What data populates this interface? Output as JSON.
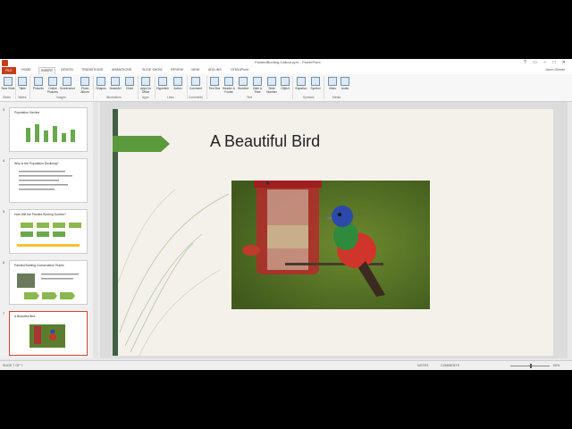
{
  "window": {
    "title": "PaintedBunting-Callout.pptx - PowerPoint",
    "controls": "? ▭ – □ ✕"
  },
  "tabs": [
    {
      "label": "FILE"
    },
    {
      "label": "HOME"
    },
    {
      "label": "INSERT"
    },
    {
      "label": "DESIGN"
    },
    {
      "label": "TRANSITIONS"
    },
    {
      "label": "ANIMATIONS"
    },
    {
      "label": "SLIDE SHOW"
    },
    {
      "label": "REVIEW"
    },
    {
      "label": "VIEW"
    },
    {
      "label": "ADD-INS"
    },
    {
      "label": "HTML5Point"
    }
  ],
  "user": "Jason Gilman",
  "ribbon": {
    "buttons": [
      {
        "label": "New Slide"
      },
      {
        "label": "Table"
      },
      {
        "label": "Pictures"
      },
      {
        "label": "Online Pictures"
      },
      {
        "label": "Screenshot"
      },
      {
        "label": "Photo Album"
      },
      {
        "label": "Shapes"
      },
      {
        "label": "SmartArt"
      },
      {
        "label": "Chart"
      },
      {
        "label": "Apps for Office"
      },
      {
        "label": "Hyperlink"
      },
      {
        "label": "Action"
      },
      {
        "label": "Comment"
      },
      {
        "label": "Text Box"
      },
      {
        "label": "Header & Footer"
      },
      {
        "label": "WordArt"
      },
      {
        "label": "Date & Time"
      },
      {
        "label": "Slide Number"
      },
      {
        "label": "Object"
      },
      {
        "label": "Equation"
      },
      {
        "label": "Symbol"
      },
      {
        "label": "Video"
      },
      {
        "label": "Audio"
      }
    ],
    "groups": [
      {
        "label": "Slides"
      },
      {
        "label": "Tables"
      },
      {
        "label": "Images"
      },
      {
        "label": "Illustrations"
      },
      {
        "label": "Apps"
      },
      {
        "label": "Links"
      },
      {
        "label": "Comments"
      },
      {
        "label": "Text"
      },
      {
        "label": "Symbols"
      },
      {
        "label": "Media"
      }
    ]
  },
  "thumbnails": [
    {
      "num": "3",
      "title": "Population Decline"
    },
    {
      "num": "4",
      "title": "Why is the Population Declining?"
    },
    {
      "num": "5",
      "title": "How Will the Painted Bunting Survive?"
    },
    {
      "num": "6",
      "title": "Painted Bunting Conservation Teams"
    },
    {
      "num": "7",
      "title": "A Beautiful Bird"
    }
  ],
  "slide": {
    "title": "A Beautiful Bird"
  },
  "status": {
    "slide_info": "SLIDE 7 OF 7",
    "notes": "NOTES",
    "comments": "COMMENTS",
    "zoom": "65%"
  },
  "colors": {
    "file_tab": "#c43e1c",
    "accent_green": "#5a9a3c",
    "slide_bar": "#3f5f45",
    "selected_border": "#d04437"
  }
}
